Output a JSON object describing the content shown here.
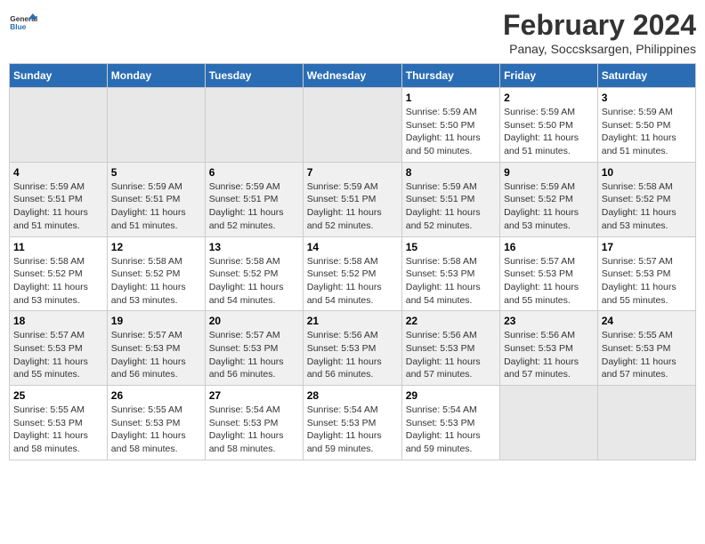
{
  "logo": {
    "general": "General",
    "blue": "Blue"
  },
  "title": "February 2024",
  "subtitle": "Panay, Soccsksargen, Philippines",
  "days_header": [
    "Sunday",
    "Monday",
    "Tuesday",
    "Wednesday",
    "Thursday",
    "Friday",
    "Saturday"
  ],
  "weeks": [
    [
      {
        "day": "",
        "sunrise": "",
        "sunset": "",
        "daylight": ""
      },
      {
        "day": "",
        "sunrise": "",
        "sunset": "",
        "daylight": ""
      },
      {
        "day": "",
        "sunrise": "",
        "sunset": "",
        "daylight": ""
      },
      {
        "day": "",
        "sunrise": "",
        "sunset": "",
        "daylight": ""
      },
      {
        "day": "1",
        "sunrise": "5:59 AM",
        "sunset": "5:50 PM",
        "daylight": "11 hours and 50 minutes."
      },
      {
        "day": "2",
        "sunrise": "5:59 AM",
        "sunset": "5:50 PM",
        "daylight": "11 hours and 51 minutes."
      },
      {
        "day": "3",
        "sunrise": "5:59 AM",
        "sunset": "5:50 PM",
        "daylight": "11 hours and 51 minutes."
      }
    ],
    [
      {
        "day": "4",
        "sunrise": "5:59 AM",
        "sunset": "5:51 PM",
        "daylight": "11 hours and 51 minutes."
      },
      {
        "day": "5",
        "sunrise": "5:59 AM",
        "sunset": "5:51 PM",
        "daylight": "11 hours and 51 minutes."
      },
      {
        "day": "6",
        "sunrise": "5:59 AM",
        "sunset": "5:51 PM",
        "daylight": "11 hours and 52 minutes."
      },
      {
        "day": "7",
        "sunrise": "5:59 AM",
        "sunset": "5:51 PM",
        "daylight": "11 hours and 52 minutes."
      },
      {
        "day": "8",
        "sunrise": "5:59 AM",
        "sunset": "5:51 PM",
        "daylight": "11 hours and 52 minutes."
      },
      {
        "day": "9",
        "sunrise": "5:59 AM",
        "sunset": "5:52 PM",
        "daylight": "11 hours and 53 minutes."
      },
      {
        "day": "10",
        "sunrise": "5:58 AM",
        "sunset": "5:52 PM",
        "daylight": "11 hours and 53 minutes."
      }
    ],
    [
      {
        "day": "11",
        "sunrise": "5:58 AM",
        "sunset": "5:52 PM",
        "daylight": "11 hours and 53 minutes."
      },
      {
        "day": "12",
        "sunrise": "5:58 AM",
        "sunset": "5:52 PM",
        "daylight": "11 hours and 53 minutes."
      },
      {
        "day": "13",
        "sunrise": "5:58 AM",
        "sunset": "5:52 PM",
        "daylight": "11 hours and 54 minutes."
      },
      {
        "day": "14",
        "sunrise": "5:58 AM",
        "sunset": "5:52 PM",
        "daylight": "11 hours and 54 minutes."
      },
      {
        "day": "15",
        "sunrise": "5:58 AM",
        "sunset": "5:53 PM",
        "daylight": "11 hours and 54 minutes."
      },
      {
        "day": "16",
        "sunrise": "5:57 AM",
        "sunset": "5:53 PM",
        "daylight": "11 hours and 55 minutes."
      },
      {
        "day": "17",
        "sunrise": "5:57 AM",
        "sunset": "5:53 PM",
        "daylight": "11 hours and 55 minutes."
      }
    ],
    [
      {
        "day": "18",
        "sunrise": "5:57 AM",
        "sunset": "5:53 PM",
        "daylight": "11 hours and 55 minutes."
      },
      {
        "day": "19",
        "sunrise": "5:57 AM",
        "sunset": "5:53 PM",
        "daylight": "11 hours and 56 minutes."
      },
      {
        "day": "20",
        "sunrise": "5:57 AM",
        "sunset": "5:53 PM",
        "daylight": "11 hours and 56 minutes."
      },
      {
        "day": "21",
        "sunrise": "5:56 AM",
        "sunset": "5:53 PM",
        "daylight": "11 hours and 56 minutes."
      },
      {
        "day": "22",
        "sunrise": "5:56 AM",
        "sunset": "5:53 PM",
        "daylight": "11 hours and 57 minutes."
      },
      {
        "day": "23",
        "sunrise": "5:56 AM",
        "sunset": "5:53 PM",
        "daylight": "11 hours and 57 minutes."
      },
      {
        "day": "24",
        "sunrise": "5:55 AM",
        "sunset": "5:53 PM",
        "daylight": "11 hours and 57 minutes."
      }
    ],
    [
      {
        "day": "25",
        "sunrise": "5:55 AM",
        "sunset": "5:53 PM",
        "daylight": "11 hours and 58 minutes."
      },
      {
        "day": "26",
        "sunrise": "5:55 AM",
        "sunset": "5:53 PM",
        "daylight": "11 hours and 58 minutes."
      },
      {
        "day": "27",
        "sunrise": "5:54 AM",
        "sunset": "5:53 PM",
        "daylight": "11 hours and 58 minutes."
      },
      {
        "day": "28",
        "sunrise": "5:54 AM",
        "sunset": "5:53 PM",
        "daylight": "11 hours and 59 minutes."
      },
      {
        "day": "29",
        "sunrise": "5:54 AM",
        "sunset": "5:53 PM",
        "daylight": "11 hours and 59 minutes."
      },
      {
        "day": "",
        "sunrise": "",
        "sunset": "",
        "daylight": ""
      },
      {
        "day": "",
        "sunrise": "",
        "sunset": "",
        "daylight": ""
      }
    ]
  ]
}
